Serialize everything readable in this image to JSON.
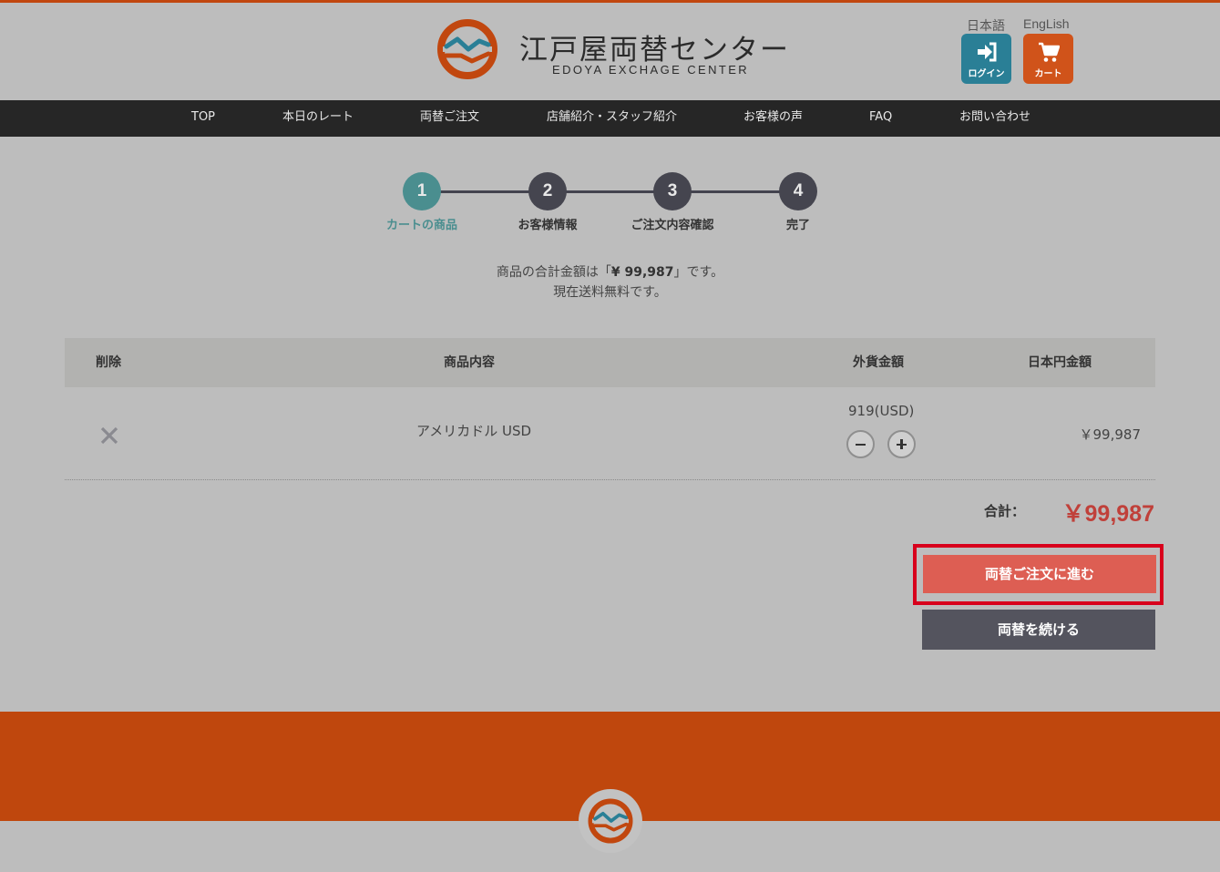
{
  "header": {
    "logo_jp": "江戸屋両替センター",
    "logo_en": "EDOYA EXCHAGE CENTER",
    "lang_ja": "日本語",
    "lang_en": "EngLish",
    "login_label": "ログイン",
    "cart_label": "カート",
    "icons": {
      "login": "login-icon",
      "cart": "cart-icon"
    }
  },
  "nav": {
    "items": [
      {
        "label": "TOP"
      },
      {
        "label": "本日のレート"
      },
      {
        "label": "両替ご注文"
      },
      {
        "label": "店舗紹介・スタッフ紹介"
      },
      {
        "label": "お客様の声"
      },
      {
        "label": "FAQ"
      },
      {
        "label": "お問い合わせ"
      }
    ]
  },
  "steps": {
    "current": 1,
    "items": [
      {
        "number": "1",
        "label": "カートの商品"
      },
      {
        "number": "2",
        "label": "お客様情報"
      },
      {
        "number": "3",
        "label": "ご注文内容確認"
      },
      {
        "number": "4",
        "label": "完了"
      }
    ]
  },
  "summary": {
    "prefix": "商品の合計金額は「",
    "amount": "¥ 99,987",
    "suffix": "」です。",
    "shipping": "現在送料無料です。"
  },
  "table": {
    "headers": {
      "delete": "削除",
      "product": "商品内容",
      "foreign": "外貨金額",
      "jpy": "日本円金額"
    },
    "rows": [
      {
        "product": "アメリカドル USD",
        "foreign_amount": "919(USD)",
        "jpy_amount": "￥99,987"
      }
    ]
  },
  "total": {
    "label": "合計：",
    "value": "￥99,987"
  },
  "actions": {
    "order_label": "両替ご注文に進む",
    "continue_label": "両替を続ける"
  },
  "colors": {
    "accent_orange": "#c1470f",
    "step_active": "#4a8e8f",
    "login_button": "#2a7f96",
    "cart_button": "#d0531a",
    "order_button": "#dd5e53",
    "continue_button": "#54545e",
    "total_price": "#c0403a",
    "highlight_border": "#d8001c"
  }
}
